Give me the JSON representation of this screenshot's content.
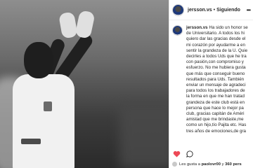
{
  "header": {
    "username": "jersson.vs",
    "separator": "•",
    "follow_status": "Siguiendo",
    "more_icon": "more-icon"
  },
  "caption": {
    "username": "jersson.vs",
    "lines": [
      "Ha sido un honor se",
      "de Universitario. A todos los hi",
      "quiero dar las gracias desde el",
      "mi corazón por ayudarme a en",
      "sentir la grandeza de la U. Quie",
      "decirles a todos Uds que he tra",
      "con pasión,con compromiso y",
      "esfuerzo. No me hubiera gusta",
      "que más que conseguir bueno",
      "resultados para Uds. También",
      "enviar un mensaje de agradeci",
      "para todos los trabajadores de",
      "la forma en que me han tratad",
      "grandeza de este club está en",
      "persona que hace lo mejor pa",
      "club, gracias capitán de Améri",
      "amistad que me brindaste,me",
      "como un hijo,tío Pajita etc. Has",
      "tres años de emociones,de gra"
    ]
  },
  "likes": {
    "prefix": "Les gusta a",
    "user": "paolovr00",
    "connector": "y",
    "count": "360 pers"
  },
  "colors": {
    "like_heart": "#ed4956",
    "text": "#262626"
  }
}
